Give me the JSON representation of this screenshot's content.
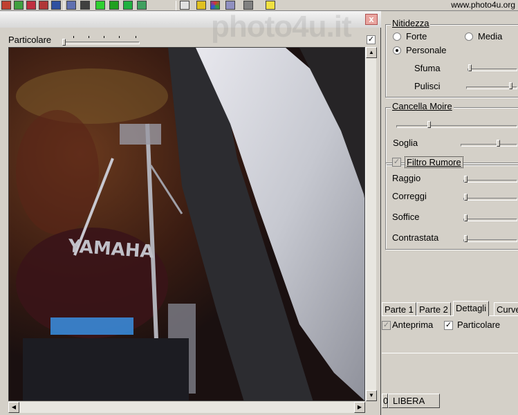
{
  "toolbar": {
    "site_text": "www.photo4u.org",
    "icons": [
      "tool-icon",
      "tool-icon",
      "tool-icon",
      "tool-icon",
      "tool-icon",
      "tool-icon",
      "tool-icon",
      "tool-icon",
      "tool-icon",
      "tool-icon",
      "grid-icon",
      "tool-icon",
      "color-icon",
      "tool-icon",
      "tool-icon",
      "help-icon"
    ]
  },
  "preview": {
    "watermark": "photo4u.it",
    "close_label": "x",
    "particolare_label": "Particolare",
    "image_text": "YAMAHA"
  },
  "nitidezza": {
    "title": "Nitidezza",
    "forte": "Forte",
    "media": "Media",
    "personale": "Personale",
    "selected": "Personale",
    "sfuma": "Sfuma",
    "pulisci": "Pulisci"
  },
  "moire": {
    "title": "Cancella Moire",
    "soglia": "Soglia"
  },
  "rumore": {
    "title": "Filtro Rumore",
    "raggio": "Raggio",
    "correggi": "Correggi",
    "soffice": "Soffice",
    "contrastata": "Contrastata"
  },
  "tabs": [
    "Parte 1",
    "Parte 2",
    "Dettagli",
    "Curve"
  ],
  "active_tab": "Dettagli",
  "options": {
    "anteprima": "Anteprima",
    "particolare": "Particolare"
  },
  "buttons": {
    "partial": "0",
    "libera": "LIBERA"
  },
  "colors": {
    "background": "#d4d0c8",
    "close": "#e9a5a0"
  }
}
